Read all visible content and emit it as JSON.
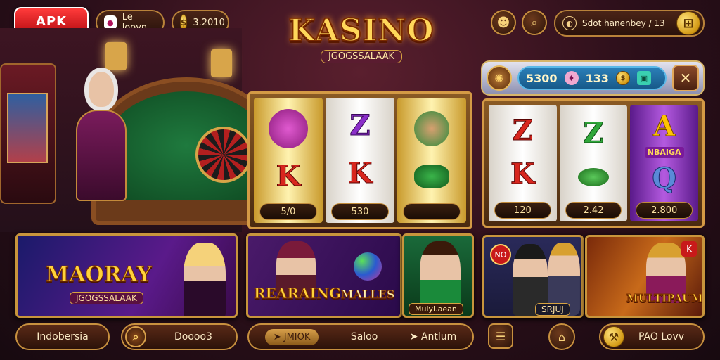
{
  "header": {
    "logo_label": "APK",
    "profile_label": "Le loovn",
    "coins_value": "3.2010",
    "search_icon": "search-icon",
    "emblem_icon": "emblem-icon",
    "notification_text": "Sdot hanenbey / 13",
    "menu_icon": "grid-menu-icon"
  },
  "title": {
    "main": "KASINO",
    "sub": "JGOGSSALAAK"
  },
  "balance": {
    "amount": "5300",
    "bet": "133"
  },
  "slot_left": {
    "reels": [
      {
        "symbols": [
          "",
          "K"
        ],
        "label": "5/0"
      },
      {
        "symbols": [
          "Z",
          "K"
        ],
        "label": "530"
      },
      {
        "symbols": [
          "",
          ""
        ],
        "label": ""
      }
    ]
  },
  "slot_right": {
    "reels": [
      {
        "symbols": [
          "Z",
          "K"
        ],
        "label": "120"
      },
      {
        "symbols": [
          "Z",
          ""
        ],
        "label": "2.42"
      },
      {
        "symbols": [
          "A",
          "Q"
        ],
        "label": "2.800"
      }
    ],
    "banner": "NBAIGA"
  },
  "cards": {
    "maoray": {
      "title": "MAORAY",
      "sub": "JGOGSSALAAK"
    },
    "rearaing": {
      "title": "REARAING",
      "extra": "MALLES"
    },
    "mulylean": {
      "label": "Mulyl.aean"
    },
    "srjuu": {
      "label": "SRJUJ",
      "badge": "NO"
    },
    "multipaumy": {
      "title": "MULTIPAUMY"
    }
  },
  "bottom": {
    "left_label": "Indobersia",
    "search_value": "Doooo3",
    "tab1": "JMIOK",
    "tab2": "Saloo",
    "tab3": "Antlum",
    "right_label": "PAO Lovv"
  },
  "colors": {
    "gold": "#ffd23a",
    "felt": "#1f7a3e",
    "accent_red": "#d8261e"
  }
}
